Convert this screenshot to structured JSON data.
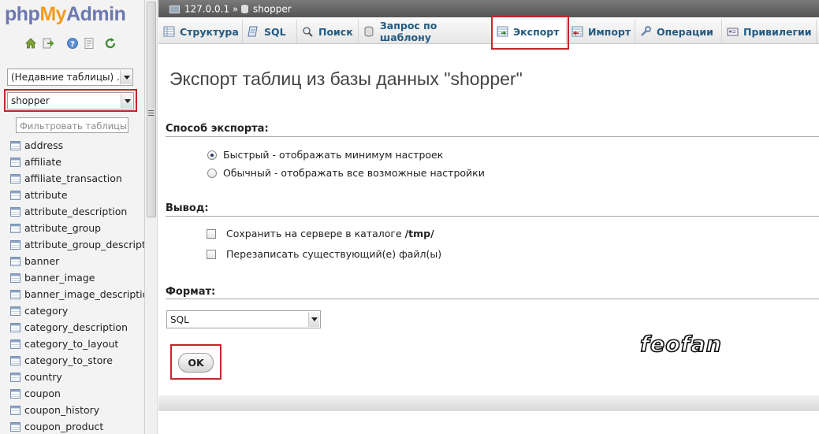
{
  "logo": {
    "php": "php",
    "my": "My",
    "admin": "Admin"
  },
  "nav_icons": [
    "home-icon",
    "exit-icon",
    "help-icon",
    "docs-icon",
    "reload-icon"
  ],
  "recent_tables_select": "(Недавние таблицы) ...",
  "database_select": "shopper",
  "filter_placeholder": "Фильтровать таблицы п",
  "tables": [
    "address",
    "affiliate",
    "affiliate_transaction",
    "attribute",
    "attribute_description",
    "attribute_group",
    "attribute_group_description",
    "banner",
    "banner_image",
    "banner_image_description",
    "category",
    "category_description",
    "category_to_layout",
    "category_to_store",
    "country",
    "coupon",
    "coupon_history",
    "coupon_product"
  ],
  "breadcrumb": {
    "server": "127.0.0.1",
    "sep": "»",
    "database": "shopper"
  },
  "tabs": [
    {
      "label": "Структура",
      "icon": "structure-icon"
    },
    {
      "label": "SQL",
      "icon": "sql-icon"
    },
    {
      "label": "Поиск",
      "icon": "search-icon"
    },
    {
      "label": "Запрос по шаблону",
      "icon": "query-icon"
    },
    {
      "label": "Экспорт",
      "icon": "export-icon",
      "active": true
    },
    {
      "label": "Импорт",
      "icon": "import-icon"
    },
    {
      "label": "Операции",
      "icon": "wrench-icon"
    },
    {
      "label": "Привилегии",
      "icon": "privileges-icon"
    }
  ],
  "page_title": "Экспорт таблиц из базы данных \"shopper\"",
  "export_method": {
    "heading": "Способ экспорта:",
    "options": [
      {
        "label": "Быстрый - отображать минимум настроек",
        "checked": true
      },
      {
        "label": "Обычный - отображать все возможные настройки",
        "checked": false
      }
    ]
  },
  "output": {
    "heading": "Вывод:",
    "save_prefix": "Сохранить на сервере в каталоге ",
    "save_dir": "/tmp/",
    "overwrite": "Перезаписать существующий(е) файл(ы)"
  },
  "format": {
    "heading": "Формат:",
    "value": "SQL"
  },
  "ok_label": "OK",
  "watermark": "feofan",
  "colors": {
    "accent": "#235a81",
    "highlight": "#c0282b",
    "logo_orange": "#f29c1f",
    "logo_blue": "#6c78af"
  }
}
